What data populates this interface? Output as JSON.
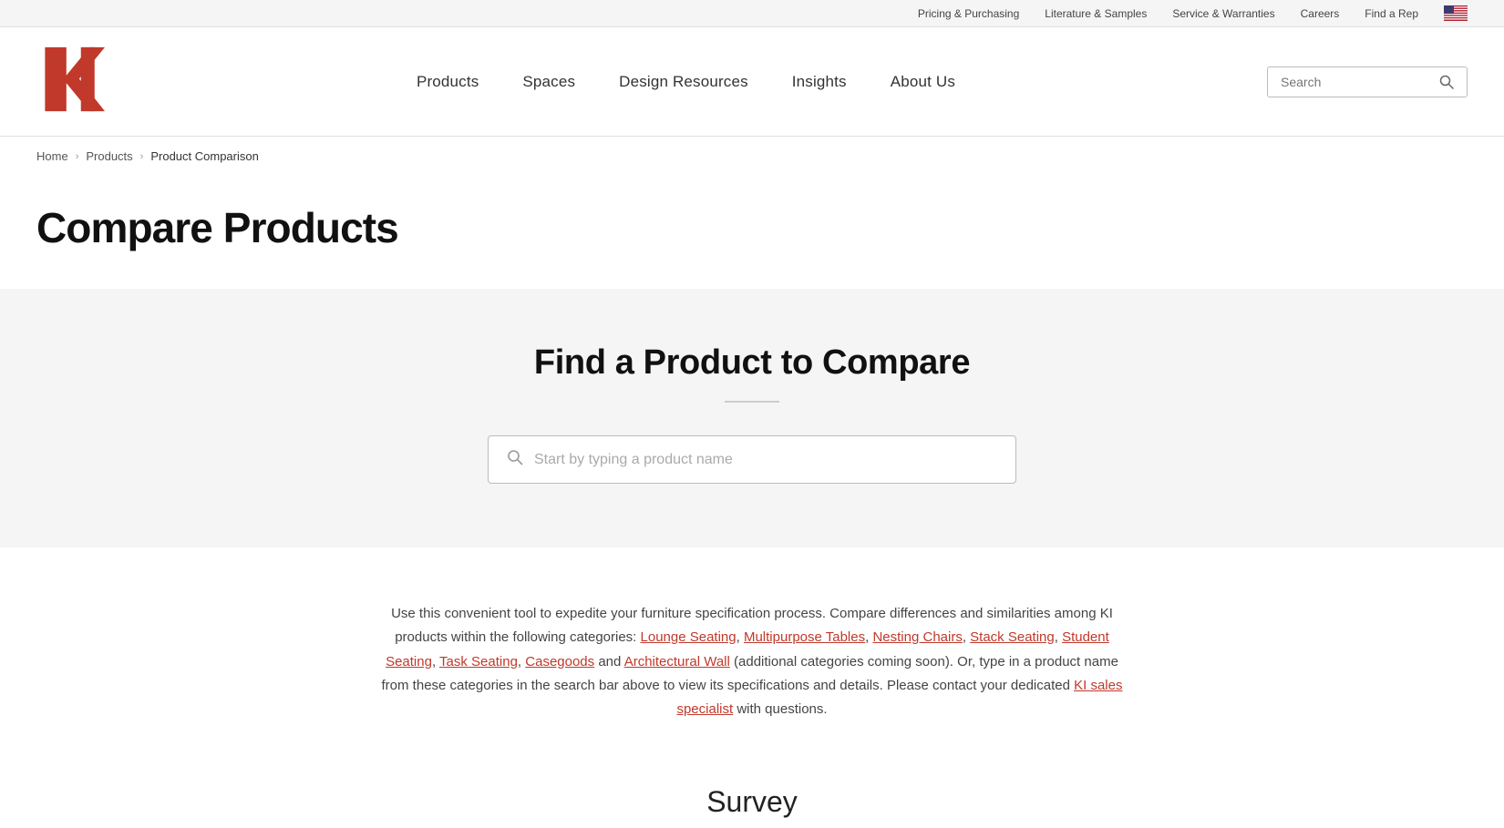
{
  "utility_bar": {
    "links": [
      {
        "label": "Pricing & Purchasing",
        "name": "pricing-purchasing-link"
      },
      {
        "label": "Literature & Samples",
        "name": "literature-samples-link"
      },
      {
        "label": "Service & Warranties",
        "name": "service-warranties-link"
      },
      {
        "label": "Careers",
        "name": "careers-link"
      },
      {
        "label": "Find a Rep",
        "name": "find-a-rep-link"
      }
    ]
  },
  "header": {
    "logo_alt": "KI Logo",
    "nav": [
      {
        "label": "Products",
        "name": "nav-products"
      },
      {
        "label": "Spaces",
        "name": "nav-spaces"
      },
      {
        "label": "Design Resources",
        "name": "nav-design-resources"
      },
      {
        "label": "Insights",
        "name": "nav-insights"
      },
      {
        "label": "About Us",
        "name": "nav-about-us"
      }
    ],
    "search_placeholder": "Search"
  },
  "breadcrumb": {
    "home": "Home",
    "products": "Products",
    "current": "Product Comparison"
  },
  "page": {
    "title": "Compare Products"
  },
  "compare": {
    "heading": "Find a Product to Compare",
    "search_placeholder": "Start by typing a product name"
  },
  "description": {
    "text_before": "Use this convenient tool to expedite your furniture specification process. Compare differences and similarities among KI products within the following categories:",
    "links": [
      {
        "label": "Lounge Seating",
        "name": "lounge-seating-link"
      },
      {
        "label": "Multipurpose Tables",
        "name": "multipurpose-tables-link"
      },
      {
        "label": "Nesting Chairs",
        "name": "nesting-chairs-link"
      },
      {
        "label": "Stack Seating",
        "name": "stack-seating-link"
      },
      {
        "label": "Student Seating",
        "name": "student-seating-link"
      },
      {
        "label": "Task Seating",
        "name": "task-seating-link"
      },
      {
        "label": "Casegoods",
        "name": "casegoods-link"
      },
      {
        "label": "Architectural Wall",
        "name": "architectural-wall-link"
      },
      {
        "label": "KI sales specialist",
        "name": "ki-sales-specialist-link"
      }
    ],
    "text_mid1": "and",
    "text_mid2": "(additional categories coming soon). Or, type in a product name from these categories in the search bar above to view its specifications and details. Please contact your dedicated",
    "text_end": "with questions."
  },
  "survey": {
    "heading": "Survey"
  }
}
